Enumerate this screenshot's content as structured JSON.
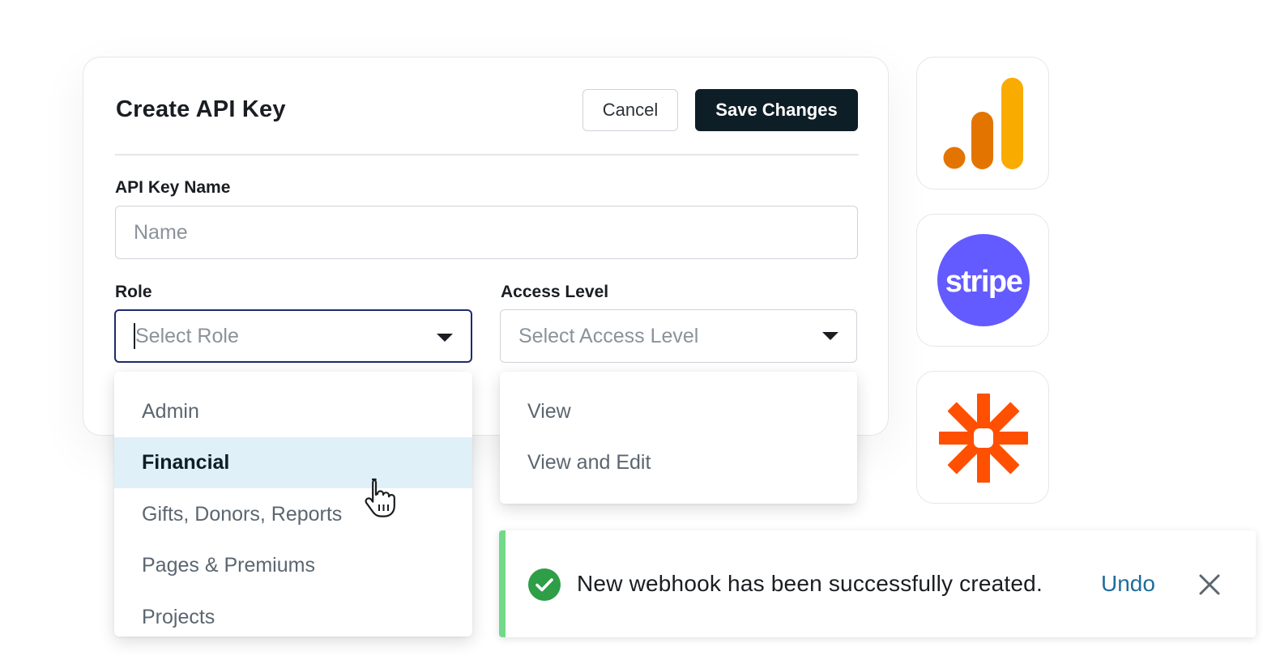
{
  "modal": {
    "title": "Create API Key",
    "cancel_label": "Cancel",
    "save_label": "Save Changes"
  },
  "form": {
    "api_key_name": {
      "label": "API Key Name",
      "placeholder": "Name",
      "value": ""
    },
    "role": {
      "label": "Role",
      "placeholder": "Select Role",
      "options": [
        "Admin",
        "Financial",
        "Gifts, Donors, Reports",
        "Pages & Premiums",
        "Projects"
      ],
      "highlighted": "Financial"
    },
    "access_level": {
      "label": "Access Level",
      "placeholder": "Select Access Level",
      "options": [
        "View",
        "View and Edit"
      ]
    }
  },
  "integrations": [
    {
      "name": "google-analytics",
      "icon": "google-analytics-icon",
      "colors": [
        "#e37400",
        "#f9ab00"
      ]
    },
    {
      "name": "stripe",
      "icon": "stripe-icon",
      "text": "stripe",
      "color": "#635bff"
    },
    {
      "name": "zapier",
      "icon": "zapier-icon",
      "color": "#ff4f00"
    }
  ],
  "toast": {
    "message": "New webhook has been successfully created.",
    "undo_label": "Undo",
    "status": "success",
    "accent_color": "#73d98a",
    "icon": "check-circle-icon"
  },
  "colors": {
    "primary_button": "#0e1e26",
    "focus_border": "#1e2a6e",
    "link": "#1f6d9b",
    "highlight_row": "#dff0f8",
    "success": "#2e9e47"
  }
}
